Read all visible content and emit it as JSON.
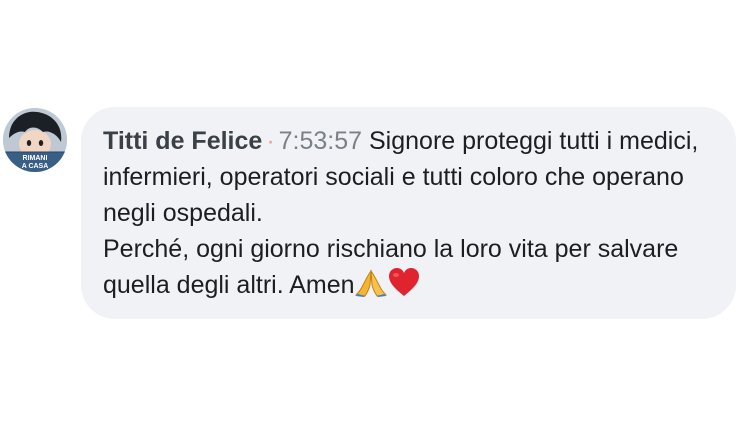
{
  "comment": {
    "author": "Titti de Felice",
    "separator": "·",
    "time": "7:53:57",
    "text_first": "Signore proteggi tutti i medici, infermieri, operatori sociali e tutti coloro che operano negli ospedali.",
    "text_second": "Perché, ogni giorno rischiano la loro vita per salvare quella degli altri. Amen",
    "avatar_badge": "RIMANI A CASA",
    "emojis": [
      "praying-hands",
      "red-heart"
    ]
  },
  "colors": {
    "bubble_background": "#f0f2f5",
    "heart": "#e0242f",
    "pray": "#f5a623"
  }
}
